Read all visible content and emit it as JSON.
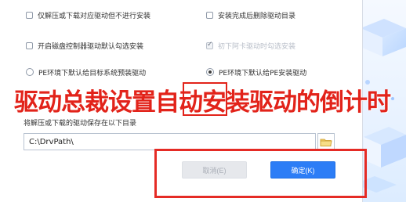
{
  "options": {
    "row1_left": "仅解压或下载对应驱动但不进行安装",
    "row1_right": "安装完成后删除驱动目录",
    "row2_left": "开启磁盘控制器驱动默认勾选安装",
    "row2_right": "初下阿卡驱动时勾选安装",
    "radio_left": "PE环境下默认给目标系统预装驱动",
    "radio_right": "PE环境下默认给PE安装驱动"
  },
  "overlay": {
    "title": "驱动总裁设置自动安装驱动的倒计时"
  },
  "save": {
    "label": "将解压或下载的驱动保存在以下目录",
    "path_value": "C:\\DrvPath\\"
  },
  "buttons": {
    "cancel": "取消(E)",
    "ok": "确定(K)"
  },
  "colors": {
    "accent": "#2c7df6",
    "annotation_red": "#e2231a"
  },
  "icons": {
    "folder": "folder-icon"
  }
}
